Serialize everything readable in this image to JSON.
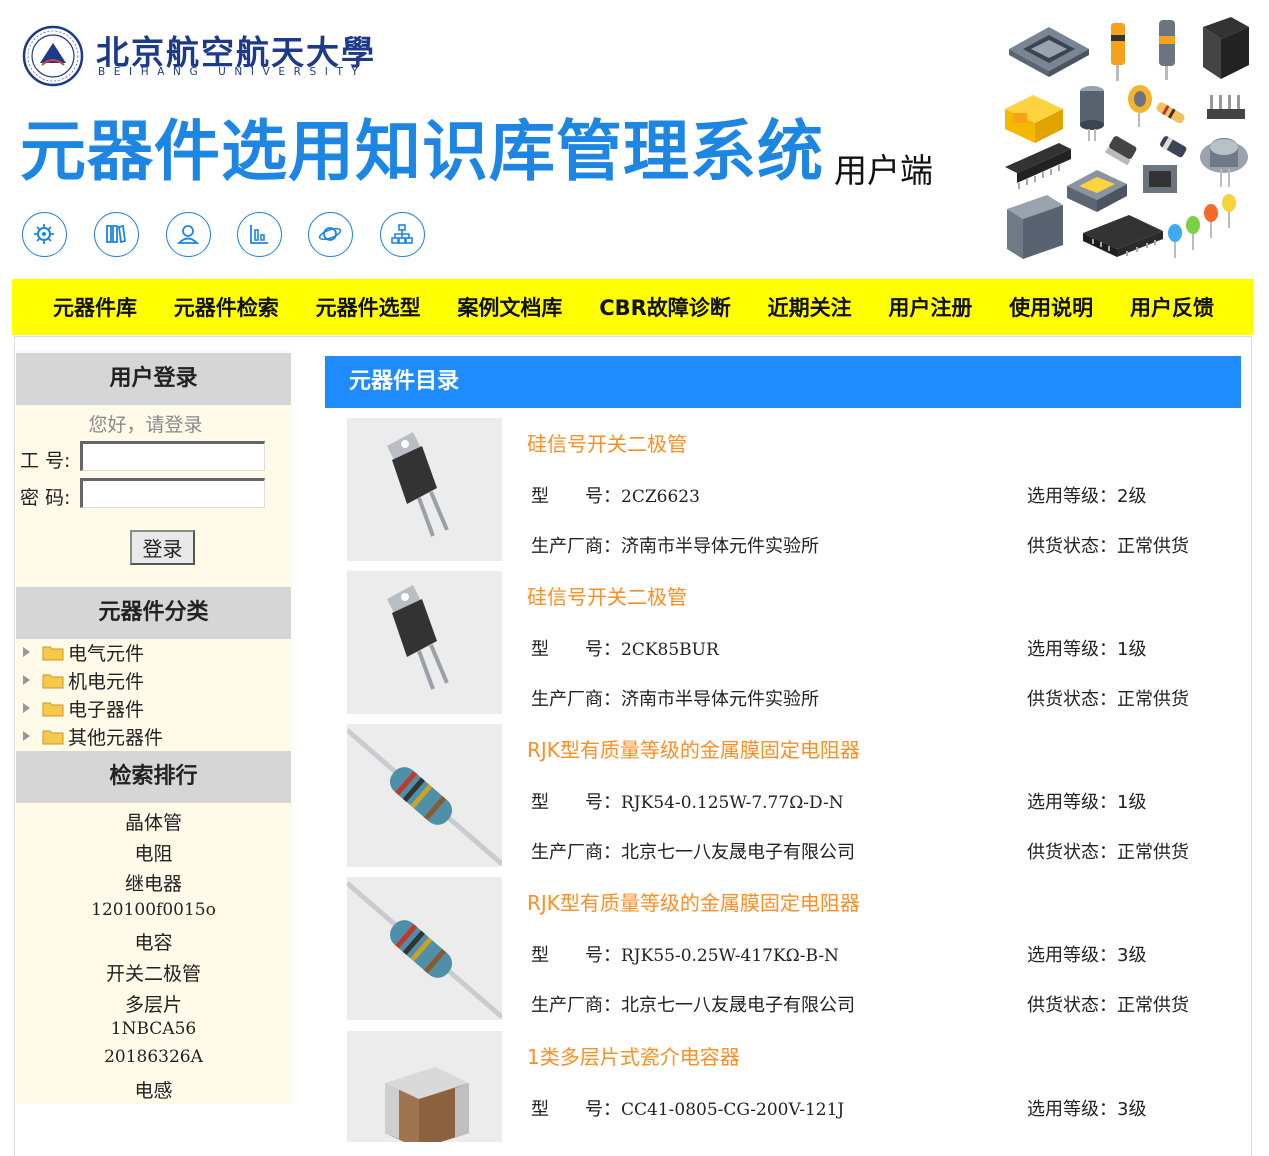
{
  "header": {
    "university_cn": "北京航空航天大學",
    "university_en": "BEIHANG UNIVERSITY",
    "app_title": "元器件选用知识库管理系统",
    "app_subtitle": "用户端",
    "icons": [
      "gear-icon",
      "books-icon",
      "user-icon",
      "chart-icon",
      "planet-icon",
      "org-chart-icon"
    ]
  },
  "nav": {
    "items": [
      "元器件库",
      "元器件检索",
      "元器件选型",
      "案例文档库",
      "CBR故障诊断",
      "近期关注",
      "用户注册",
      "使用说明",
      "用户反馈"
    ]
  },
  "login": {
    "title": "用户登录",
    "greeting": "您好，请登录",
    "id_label": "工 号:",
    "id_value": "",
    "password_label": "密 码:",
    "password_value": "",
    "button": "登录"
  },
  "categories": {
    "title": "元器件分类",
    "items": [
      "电气元件",
      "机电元件",
      "电子器件",
      "其他元器件"
    ]
  },
  "ranking": {
    "title": "检索排行",
    "items": [
      "晶体管",
      "电阻",
      "继电器",
      "120100f0015o",
      "电容",
      "开关二极管",
      "多层片",
      "1NBCA56",
      "20186326A",
      "电感"
    ]
  },
  "catalog": {
    "title": "元器件目录",
    "labels": {
      "model": "型　　号：",
      "maker": "生产厂商：",
      "grade": "选用等级：",
      "supply": "供货状态："
    },
    "items": [
      {
        "name": "硅信号开关二极管",
        "model": "2CZ6623",
        "maker": "济南市半导体元件实验所",
        "grade": "2级",
        "supply": "正常供货",
        "image": "diode-icon"
      },
      {
        "name": "硅信号开关二极管",
        "model": "2CK85BUR",
        "maker": "济南市半导体元件实验所",
        "grade": "1级",
        "supply": "正常供货",
        "image": "diode-icon"
      },
      {
        "name": "RJK型有质量等级的金属膜固定电阻器",
        "model": "RJK54-0.125W-7.77Ω-D-N",
        "maker": "北京七一八友晟电子有限公司",
        "grade": "1级",
        "supply": "正常供货",
        "image": "resistor-icon"
      },
      {
        "name": "RJK型有质量等级的金属膜固定电阻器",
        "model": "RJK55-0.25W-417KΩ-B-N",
        "maker": "北京七一八友晟电子有限公司",
        "grade": "3级",
        "supply": "正常供货",
        "image": "resistor-icon"
      },
      {
        "name": "1类多层片式瓷介电容器",
        "model": "CC41-0805-CG-200V-121J",
        "grade": "3级",
        "image": "capacitor-icon"
      }
    ]
  },
  "colors": {
    "title_blue": "#1d86e2",
    "nav_yellow": "#ffff00",
    "catalog_head_blue": "#1e8bff",
    "item_title_orange": "#ff8e22",
    "sidebar_bg": "#fffbe8",
    "sidebar_head_gray": "#d6d6d6"
  }
}
